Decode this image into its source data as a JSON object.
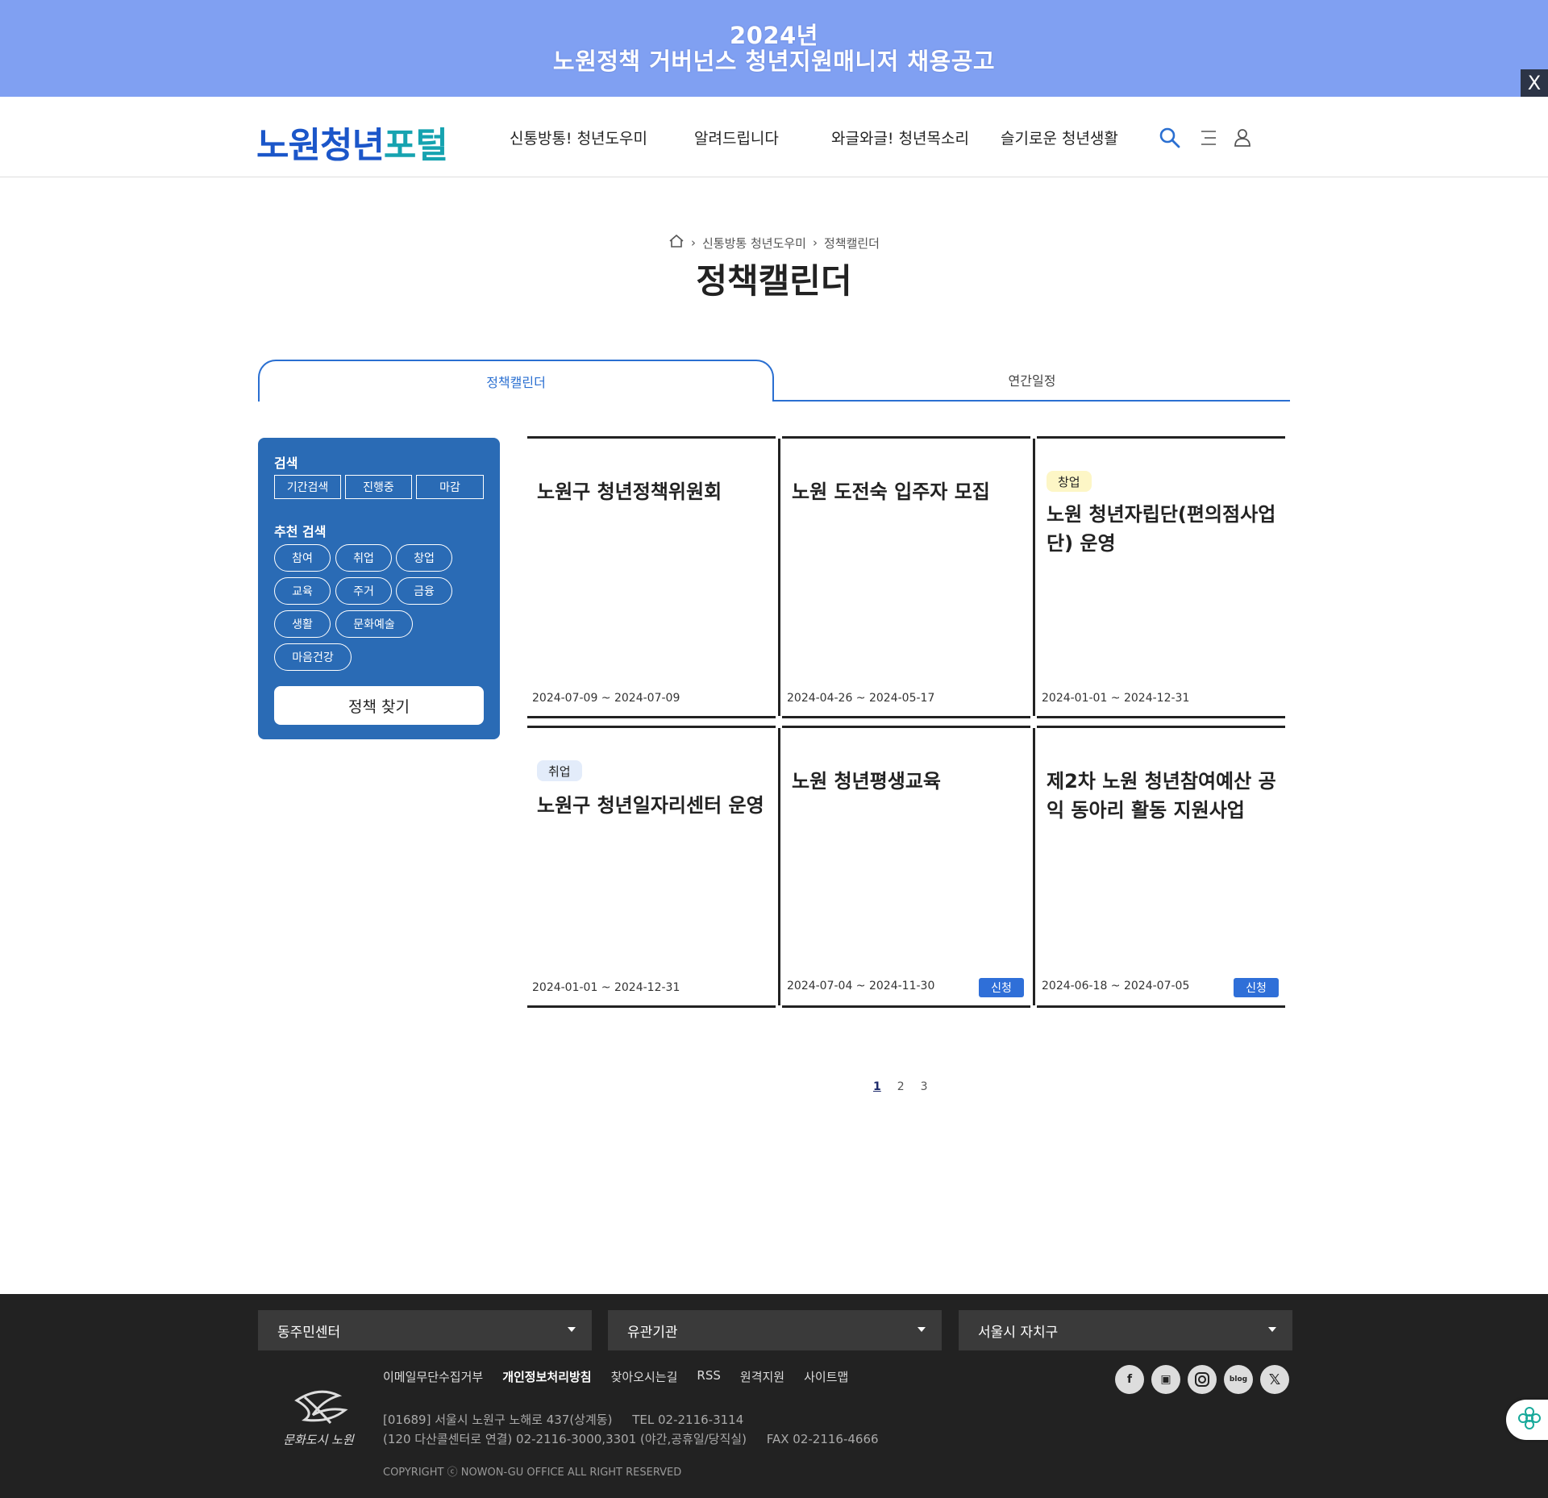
{
  "banner": {
    "line1": "2024년",
    "line2": "노원정책 거버넌스 청년지원매니저 채용공고",
    "close": "X"
  },
  "header": {
    "logo_part1": "노원청년",
    "logo_part2": "포털",
    "nav": [
      "신통방통! 청년도우미",
      "알려드립니다",
      "와글와글! 청년목소리",
      "슬기로운 청년생활"
    ],
    "icons": [
      "search-icon",
      "menu-icon",
      "user-icon"
    ]
  },
  "breadcrumb": {
    "items": [
      "신통방통 청년도우미",
      "정책캘린더"
    ]
  },
  "page_title": "정책캘린더",
  "tabs": [
    "정책캘린더",
    "연간일정"
  ],
  "sidebar": {
    "search_label": "검색",
    "search_buttons": [
      "기간검색",
      "진행중",
      "마감"
    ],
    "recommend_label": "추천 검색",
    "tags": [
      "참여",
      "취업",
      "창업",
      "교육",
      "주거",
      "금융",
      "생활",
      "문화예술",
      "마음건강"
    ],
    "find_button": "정책 찾기"
  },
  "cards": [
    {
      "title": "노원구 청년정책위원회",
      "category": "",
      "date": "2024-07-09 ~ 2024-07-09",
      "apply": ""
    },
    {
      "title": "노원 도전숙 입주자 모집",
      "category": "",
      "date": "2024-04-26 ~ 2024-05-17",
      "apply": ""
    },
    {
      "title": "노원 청년자립단(편의점사업단) 운영",
      "category": "창업",
      "date": "2024-01-01 ~ 2024-12-31",
      "apply": ""
    },
    {
      "title": "노원구 청년일자리센터 운영",
      "category": "취업",
      "date": "2024-01-01 ~ 2024-12-31",
      "apply": ""
    },
    {
      "title": "노원 청년평생교육",
      "category": "",
      "date": "2024-07-04 ~ 2024-11-30",
      "apply": "신청"
    },
    {
      "title": "제2차 노원 청년참여예산 공익 동아리 활동 지원사업",
      "category": "",
      "date": "2024-06-18 ~ 2024-07-05",
      "apply": "신청"
    }
  ],
  "colors": {
    "banner": "#80a0f2",
    "accent": "#2a6fd1",
    "sidebar": "#2a6bb5",
    "tag_startup": "#fdf6c6",
    "tag_job": "#e3ecfa",
    "footer": "#222222"
  },
  "pagination": [
    "1",
    "2",
    "3"
  ],
  "footer": {
    "selects": [
      "동주민센터",
      "유관기관",
      "서울시 자치구"
    ],
    "links": [
      "이메일무단수집거부",
      "개인정보처리방침",
      "찾아오시는길",
      "RSS",
      "원격지원",
      "사이트맵"
    ],
    "address_line1": "[01689] 서울시 노원구 노해로 437(상계동)",
    "tel": "TEL 02-2116-3114",
    "address_line2": "(120 다산콜센터로 연결) 02-2116-3000,3301 (야간,공휴일/당직실)",
    "fax": "FAX 02-2116-4666",
    "copyright": "COPYRIGHT ⓒ NOWON-GU OFFICE ALL RIGHT RESERVED",
    "logo_text": "문화도시 노원",
    "sns": [
      "facebook-icon",
      "kakao-icon",
      "instagram-icon",
      "blog-icon",
      "x-icon"
    ]
  }
}
